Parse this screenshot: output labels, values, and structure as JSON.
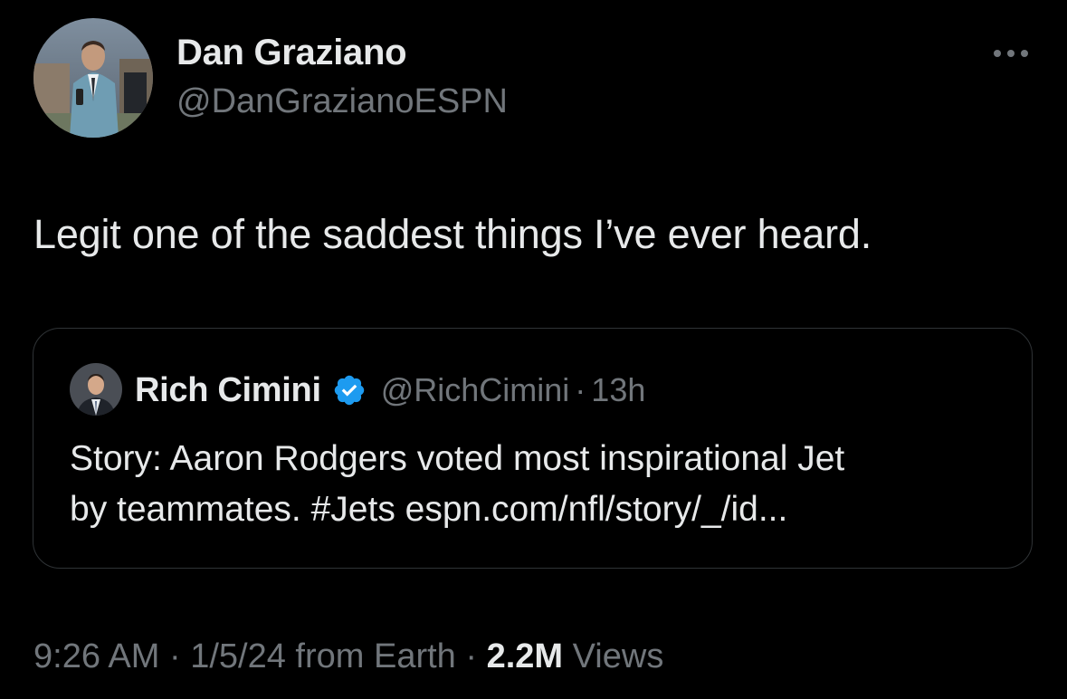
{
  "tweet": {
    "author_name": "Dan Graziano",
    "author_handle": "@DanGrazianoESPN",
    "text": "Legit one of the saddest things I’ve ever heard.",
    "more_icon": "more-horizontal-icon"
  },
  "quote": {
    "author_name": "Rich Cimini",
    "verified_icon": "verified-badge-icon",
    "author_handle": "@RichCimini",
    "separator": "·",
    "time": "13h",
    "line1": "Story: Aaron Rodgers voted most inspirational Jet",
    "line2": "by teammates. #Jets espn.com/nfl/story/_/id..."
  },
  "meta": {
    "time": "9:26 AM",
    "sep1": " · ",
    "date": "1/5/24",
    "source": " from Earth",
    "sep2": " · ",
    "views_count": "2.2M",
    "views_label": " Views"
  },
  "colors": {
    "background": "#000000",
    "primary_text": "#e7e9ea",
    "secondary_text": "#71767b",
    "verified_blue": "#1d9bf0",
    "border": "#2f3336"
  }
}
